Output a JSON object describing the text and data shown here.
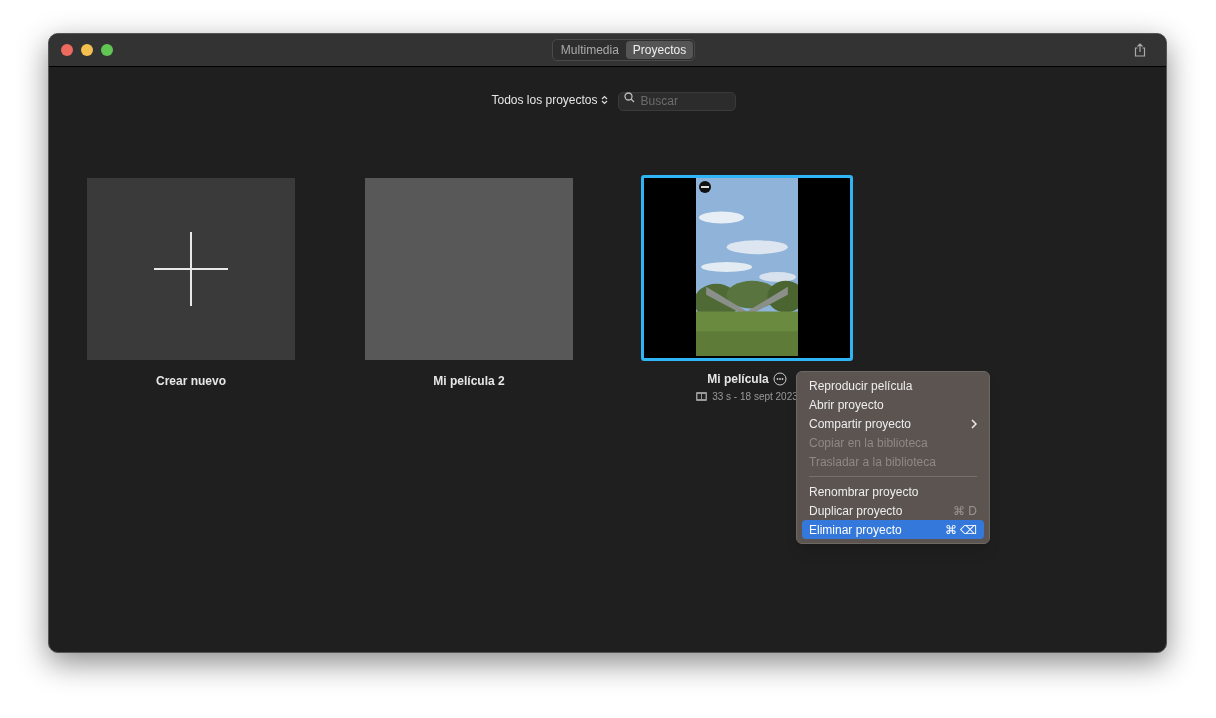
{
  "toolbar": {
    "tabs": [
      {
        "label": "Multimedia",
        "selected": false
      },
      {
        "label": "Proyectos",
        "selected": true
      }
    ]
  },
  "filter": {
    "label": "Todos los proyectos",
    "search_placeholder": "Buscar"
  },
  "projects": [
    {
      "kind": "new",
      "title": "Crear nuevo",
      "selected": false
    },
    {
      "kind": "blank",
      "title": "Mi película 2",
      "selected": false
    },
    {
      "kind": "video",
      "title": "Mi película",
      "subtitle": "33 s - 18 sept 2023",
      "selected": true
    }
  ],
  "context_menu": {
    "items": [
      {
        "label": "Reproducir película",
        "disabled": false,
        "selected": false
      },
      {
        "label": "Abrir proyecto",
        "disabled": false,
        "selected": false
      },
      {
        "label": "Compartir proyecto",
        "disabled": false,
        "selected": false,
        "submenu": true
      },
      {
        "label": "Copiar en la biblioteca",
        "disabled": true,
        "selected": false
      },
      {
        "label": "Trasladar a la biblioteca",
        "disabled": true,
        "selected": false,
        "separator_after": true
      },
      {
        "label": "Renombrar proyecto",
        "disabled": false,
        "selected": false
      },
      {
        "label": "Duplicar proyecto",
        "disabled": false,
        "selected": false,
        "shortcut": "⌘ D"
      },
      {
        "label": "Eliminar proyecto",
        "disabled": false,
        "selected": true,
        "shortcut": "⌘ ⌫"
      }
    ]
  }
}
